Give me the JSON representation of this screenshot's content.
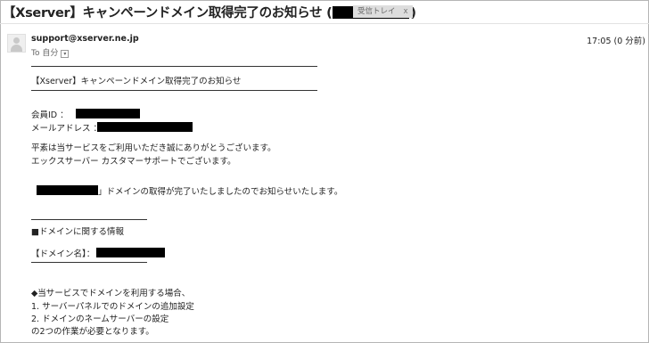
{
  "subject": {
    "prefix": "【Xserver】キャンペーンドメイン取得完了のお知らせ (",
    "suffix": ")"
  },
  "label": {
    "text": "受信トレイ",
    "close": "x"
  },
  "message": {
    "sender": "support@xserver.ne.jp",
    "to": "To 自分",
    "time": "17:05 (0 分前)"
  },
  "body": {
    "heading": "【Xserver】キャンペーンドメイン取得完了のお知らせ",
    "member_id_label": "会員ID ：",
    "email_label": "メールアドレス ：",
    "greeting_1": "平素は当サービスをご利用いただき誠にありがとうございます。",
    "greeting_2": "エックスサーバー カスタマーサポートでございます。",
    "notice_open": "「",
    "notice_rest": "」ドメインの取得が完了いたしましたのでお知らせいたします。",
    "section_title": "■ドメインに関する情報",
    "domain_label": "【ドメイン名】：",
    "usage_heading": "◆当サービスでドメインを利用する場合、",
    "step_1": "1. サーバーパネルでのドメインの追加設定",
    "step_2": "2. ドメインのネームサーバーの設定",
    "closing": "の2つの作業が必要となります。"
  },
  "colors": {
    "text": "#222222",
    "muted": "#666666",
    "chip_bg": "#dddddd",
    "redaction": "#000000"
  },
  "icons": {
    "avatar": "default-avatar-icon",
    "to_dropdown": "chevron-down-icon"
  }
}
